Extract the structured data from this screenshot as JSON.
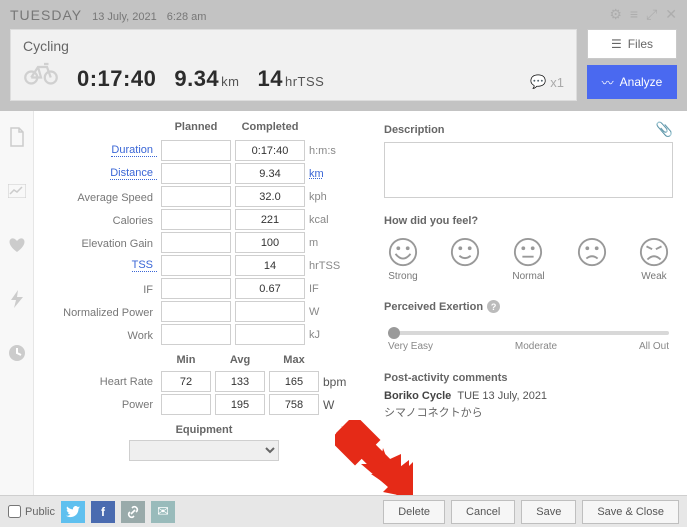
{
  "header": {
    "dayOfWeek": "TUESDAY",
    "date": "13 July, 2021",
    "time": "6:28 am",
    "activityTitle": "Cycling",
    "duration": "0:17:40",
    "distanceValue": "9.34",
    "distanceUnit": "km",
    "tssValue": "14",
    "tssUnit": "hrTSS",
    "commentsCount": "x1",
    "annotation": "!?",
    "filesBtn": "Files",
    "analyzeBtn": "Analyze"
  },
  "planCompleted": {
    "plannedHeader": "Planned",
    "completedHeader": "Completed",
    "rows": {
      "duration": {
        "label": "Duration",
        "planned": "",
        "completed": "0:17:40",
        "unit": "h:m:s"
      },
      "distance": {
        "label": "Distance",
        "planned": "",
        "completed": "9.34",
        "unit": "km"
      },
      "avgSpeed": {
        "label": "Average Speed",
        "planned": "",
        "completed": "32.0",
        "unit": "kph"
      },
      "calories": {
        "label": "Calories",
        "planned": "",
        "completed": "221",
        "unit": "kcal"
      },
      "elevGain": {
        "label": "Elevation Gain",
        "planned": "",
        "completed": "100",
        "unit": "m"
      },
      "tss": {
        "label": "TSS",
        "planned": "",
        "completed": "14",
        "unit": "hrTSS"
      },
      "if": {
        "label": "IF",
        "planned": "",
        "completed": "0.67",
        "unit": "IF"
      },
      "np": {
        "label": "Normalized Power",
        "planned": "",
        "completed": "",
        "unit": "W"
      },
      "work": {
        "label": "Work",
        "planned": "",
        "completed": "",
        "unit": "kJ"
      }
    }
  },
  "stats": {
    "minHeader": "Min",
    "avgHeader": "Avg",
    "maxHeader": "Max",
    "heartRate": {
      "label": "Heart Rate",
      "min": "72",
      "avg": "133",
      "max": "165",
      "unit": "bpm"
    },
    "power": {
      "label": "Power",
      "min": "",
      "avg": "195",
      "max": "758",
      "unit": "W"
    }
  },
  "equipment": {
    "header": "Equipment",
    "selected": ""
  },
  "description": {
    "label": "Description",
    "value": ""
  },
  "feel": {
    "label": "How did you feel?",
    "options": [
      "Strong",
      "",
      "Normal",
      "",
      "Weak"
    ]
  },
  "rpe": {
    "label": "Perceived Exertion",
    "scale": {
      "left": "Very Easy",
      "mid": "Moderate",
      "right": "All Out"
    }
  },
  "postComments": {
    "label": "Post-activity comments",
    "author": "Boriko Cycle",
    "date": "TUE 13 July, 2021",
    "text": "シマノコネクトから"
  },
  "footer": {
    "public": "Public",
    "delete": "Delete",
    "cancel": "Cancel",
    "save": "Save",
    "saveClose": "Save & Close"
  }
}
